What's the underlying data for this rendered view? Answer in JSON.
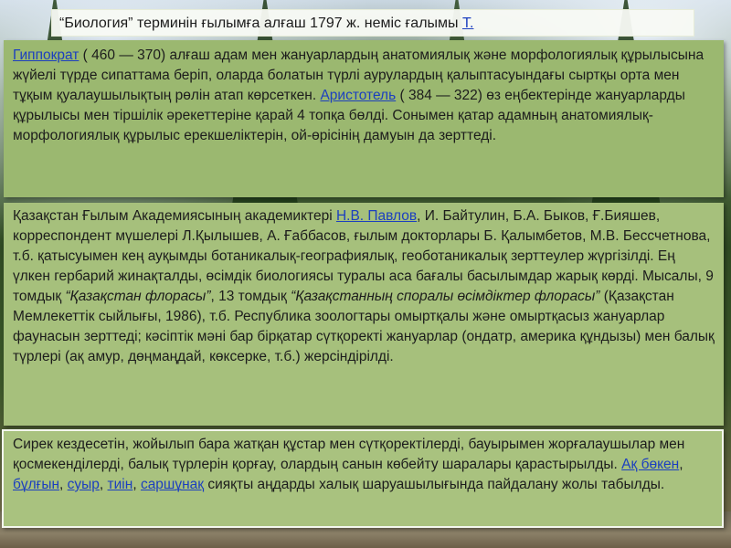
{
  "top": {
    "text": "“Биология” терминін ғылымға алғаш 1797 ж. неміс ғалымы ",
    "link": "Т."
  },
  "p1": {
    "link1": "Гиппократ",
    "t1": " ( 460 — 370) алғаш адам мен жануарлардың анатомиялық және морфологиялық құрылысына жүйелі түрде сипаттама беріп, оларда болатын түрлі аурулардың қалыптасуындағы сыртқы орта мен тұқым қуалаушылықтың рөлін атап көрсеткен. ",
    "link2": "Аристотель",
    "t2": " ( 384 — 322) өз еңбектерінде жануарларды құрылысы мен тіршілік әрекеттеріне қарай 4 топқа бөлді. Сонымен қатар адамның анатомиялық-морфологиялық құрылыс ерекшеліктерін, ой-өрісінің дамуын да зерттеді."
  },
  "p2": {
    "t1": "Қазақстан Ғылым Академиясының академиктері ",
    "link1": "Н.В. Павлов",
    "t2": ", И. Байтулин, Б.А. Быков, Ғ.Бияшев, корреспондент мүшелері Л.Қылышев, А. Ғаббасов, ғылым докторлары Б. Қалымбетов, М.В. Бессчетнова, т.б. қатысуымен кең ауқымды ботаникалық-географиялық, геоботаникалық зерттеулер жүргізілді. Ең үлкен гербарий жинақталды, өсімдік биологиясы туралы аса бағалы басылымдар жарық көрді. Мысалы, 9 томдық ",
    "em1": "“Қазақстан флорасы”",
    "t3": ", 13 томдық ",
    "em2": "“Қазақстанның споралы өсімдіктер флорасы”",
    "t4": " (Қазақстан Мемлекеттік сыйлығы, 1986), т.б. Республика зоологтары омыртқалы және омыртқасыз жануарлар фаунасын зерттеді; кәсіптік мәні бар бірқатар сүтқоректі жануарлар (ондатр, америка құндызы) мен балық түрлері (ақ амур, дөңмаңдай, көксерке, т.б.) жерсіндірілді."
  },
  "p3": {
    "t1": "Сирек кездесетін, жойылып бара жатқан құстар мен сүтқоректілерді, бауырымен жорғалаушылар мен қосмекенділерді, балық түрлерін қорғау, олардың санын көбейту шаралары қарастырылды. ",
    "link1": "Ақ бөкен",
    "sep1": ", ",
    "link2": "бұлғын",
    "sep2": ", ",
    "link3": "суыр",
    "sep3": ", ",
    "link4": "тиін",
    "sep4": ", ",
    "link5": "саршұнақ",
    "t2": " сияқты аңдарды халық шаруашылығында пайдалану жолы табылды."
  }
}
